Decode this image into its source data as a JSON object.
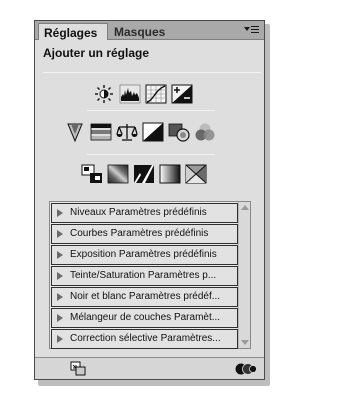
{
  "tabs": [
    {
      "label": "Réglages",
      "active": true
    },
    {
      "label": "Masques",
      "active": false
    }
  ],
  "panel_menu_icon": "panel-menu-icon",
  "heading": "Ajouter un réglage",
  "adjustment_icons": {
    "row1": [
      "brightness-contrast-icon",
      "levels-icon",
      "curves-icon",
      "exposure-icon"
    ],
    "row2": [
      "vibrance-icon",
      "hue-saturation-icon",
      "color-balance-icon",
      "black-white-icon",
      "photo-filter-icon",
      "channel-mixer-icon"
    ],
    "row3": [
      "invert-icon",
      "posterize-icon",
      "threshold-icon",
      "gradient-map-icon",
      "selective-color-icon"
    ]
  },
  "presets": [
    "Niveaux Paramètres prédéfinis",
    "Courbes Paramètres prédéfinis",
    "Exposition Paramètres prédéfinis",
    "Teinte/Saturation Paramètres p...",
    "Noir et blanc Paramètres prédéf...",
    "Mélangeur de couches Paramèt...",
    "Correction sélective Paramètres..."
  ],
  "footer_icons": [
    "clip-layer-icon",
    "adjustment-options-icon"
  ],
  "colors": {
    "panel": "#dedede",
    "tabbar": "#a9a9a9",
    "border": "#4a4a4a"
  }
}
